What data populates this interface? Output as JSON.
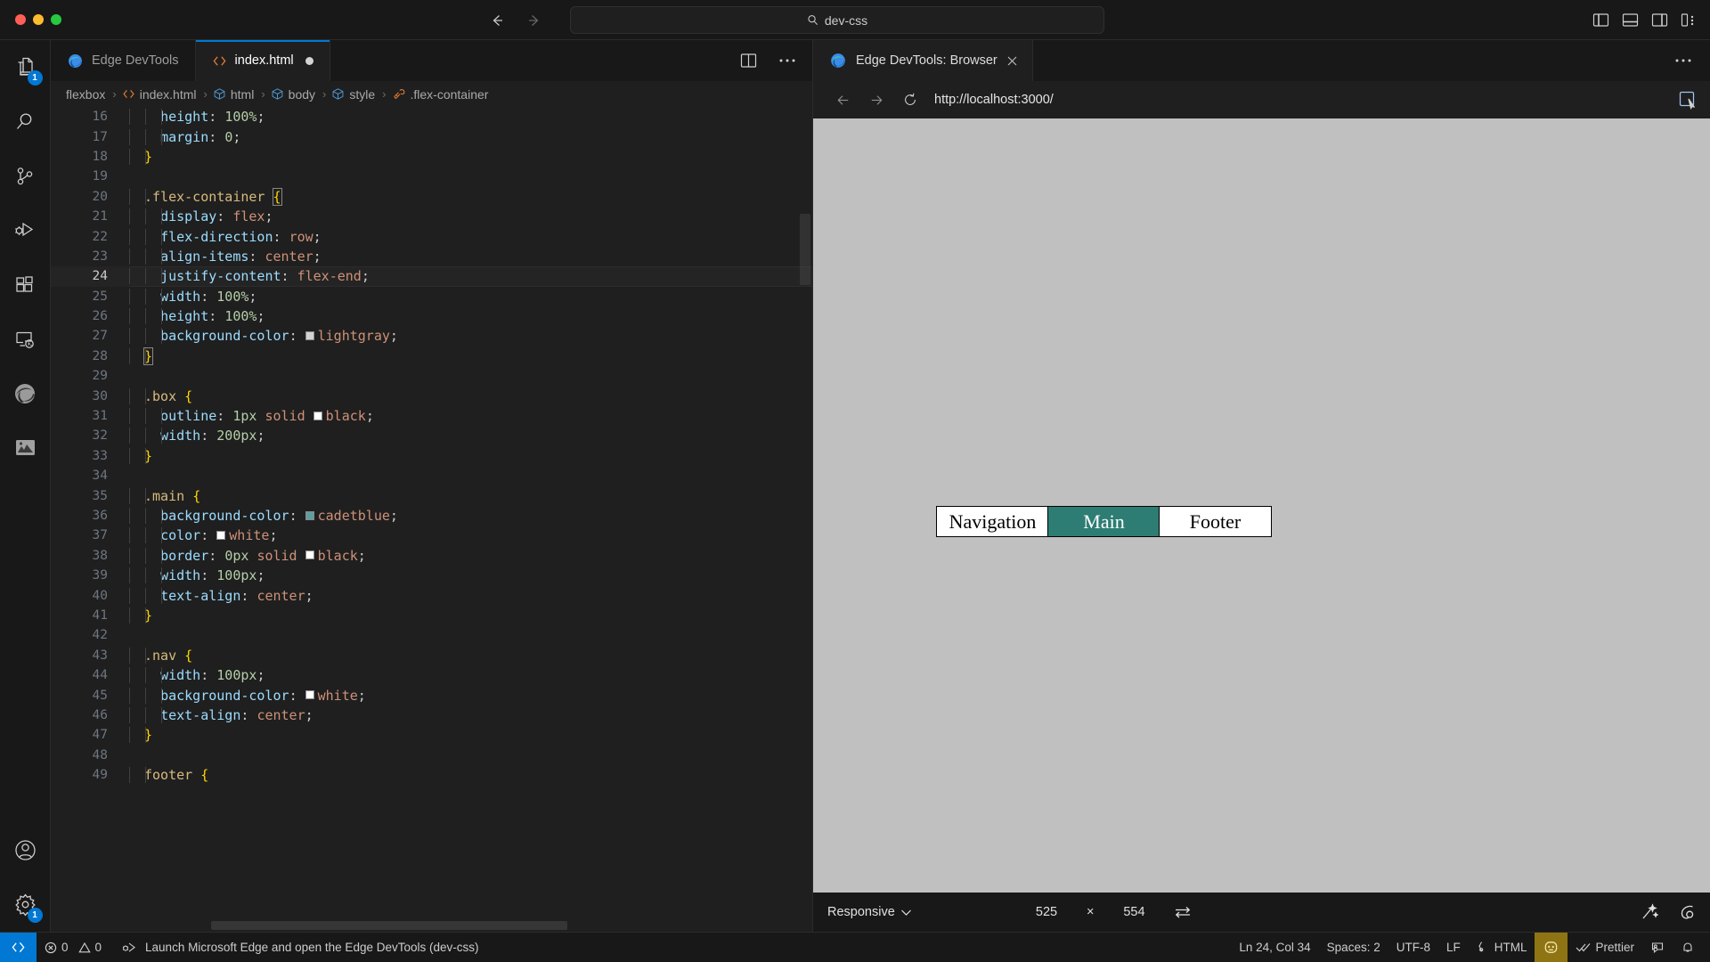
{
  "titlebar": {
    "window_controls": [
      "close",
      "minimize",
      "maximize"
    ],
    "back_icon": "arrow-left-icon",
    "forward_icon": "arrow-right-icon",
    "command_center_text": "dev-css",
    "command_center_icon": "search-icon",
    "layout_icons": [
      "toggle-primary-sidebar-icon",
      "toggle-panel-icon",
      "toggle-secondary-sidebar-icon",
      "customize-layout-icon"
    ]
  },
  "activitybar": {
    "items": [
      {
        "name": "explorer",
        "icon": "files-icon",
        "badge": "1"
      },
      {
        "name": "search",
        "icon": "search-icon",
        "badge": ""
      },
      {
        "name": "source-control",
        "icon": "source-control-icon",
        "badge": ""
      },
      {
        "name": "run-and-debug",
        "icon": "run-debug-icon",
        "badge": ""
      },
      {
        "name": "extensions",
        "icon": "extensions-icon",
        "badge": ""
      },
      {
        "name": "remote-explorer",
        "icon": "remote-explorer-icon",
        "badge": ""
      },
      {
        "name": "edge-devtools",
        "icon": "edge-logo-icon",
        "badge": ""
      },
      {
        "name": "perl-camel",
        "icon": "camel-icon",
        "badge": ""
      }
    ],
    "bottom": [
      {
        "name": "accounts",
        "icon": "account-icon",
        "badge": ""
      },
      {
        "name": "manage-settings",
        "icon": "gear-icon",
        "badge": "1"
      }
    ]
  },
  "editor": {
    "tabs": [
      {
        "label": "Edge DevTools",
        "icon": "edge-logo-icon",
        "active": false,
        "dirty": false
      },
      {
        "label": "index.html",
        "icon": "html-code-icon",
        "active": true,
        "dirty": true
      }
    ],
    "tab_actions": [
      {
        "name": "split-editor",
        "icon": "split-editor-icon"
      },
      {
        "name": "more-actions",
        "icon": "ellipsis-icon"
      }
    ],
    "breadcrumbs": [
      {
        "label": "flexbox",
        "icon": ""
      },
      {
        "label": "index.html",
        "icon": "html-code-icon"
      },
      {
        "label": "html",
        "icon": "element-icon"
      },
      {
        "label": "body",
        "icon": "element-icon"
      },
      {
        "label": "style",
        "icon": "element-icon"
      },
      {
        "label": ".flex-container",
        "icon": "css-ruler-icon"
      }
    ],
    "breadcrumb_separator": "›",
    "first_visible_line": 16,
    "current_line": 24,
    "lines": [
      {
        "n": 16,
        "tokens": [
          {
            "t": "  ",
            "c": "k-punc"
          },
          {
            "t": "height",
            "c": "k-prop"
          },
          {
            "t": ": ",
            "c": "k-punc"
          },
          {
            "t": "100%",
            "c": "k-num"
          },
          {
            "t": ";",
            "c": "k-punc"
          }
        ],
        "indents": [
          1,
          2,
          3
        ],
        "current": false
      },
      {
        "n": 17,
        "tokens": [
          {
            "t": "  ",
            "c": "k-punc"
          },
          {
            "t": "margin",
            "c": "k-prop"
          },
          {
            "t": ": ",
            "c": "k-punc"
          },
          {
            "t": "0",
            "c": "k-num"
          },
          {
            "t": ";",
            "c": "k-punc"
          }
        ],
        "indents": [
          1,
          2,
          3
        ],
        "current": false
      },
      {
        "n": 18,
        "tokens": [
          {
            "t": "}",
            "c": "k-brace"
          }
        ],
        "indents": [
          1,
          2
        ],
        "current": false
      },
      {
        "n": 19,
        "tokens": [],
        "indents": [
          1,
          2
        ],
        "current": false
      },
      {
        "n": 20,
        "tokens": [
          {
            "t": ".flex-container ",
            "c": "k-sel"
          },
          {
            "t": "{",
            "c": "k-brace-hl"
          }
        ],
        "indents": [
          1,
          2
        ],
        "current": false
      },
      {
        "n": 21,
        "tokens": [
          {
            "t": "  ",
            "c": "k-punc"
          },
          {
            "t": "display",
            "c": "k-prop"
          },
          {
            "t": ": ",
            "c": "k-punc"
          },
          {
            "t": "flex",
            "c": "k-val"
          },
          {
            "t": ";",
            "c": "k-punc"
          }
        ],
        "indents": [
          1,
          2,
          3
        ],
        "current": false
      },
      {
        "n": 22,
        "tokens": [
          {
            "t": "  ",
            "c": "k-punc"
          },
          {
            "t": "flex-direction",
            "c": "k-prop"
          },
          {
            "t": ": ",
            "c": "k-punc"
          },
          {
            "t": "row",
            "c": "k-val"
          },
          {
            "t": ";",
            "c": "k-punc"
          }
        ],
        "indents": [
          1,
          2,
          3
        ],
        "current": false
      },
      {
        "n": 23,
        "tokens": [
          {
            "t": "  ",
            "c": "k-punc"
          },
          {
            "t": "align-items",
            "c": "k-prop"
          },
          {
            "t": ": ",
            "c": "k-punc"
          },
          {
            "t": "center",
            "c": "k-val"
          },
          {
            "t": ";",
            "c": "k-punc"
          }
        ],
        "indents": [
          1,
          2,
          3
        ],
        "current": false
      },
      {
        "n": 24,
        "tokens": [
          {
            "t": "  ",
            "c": "k-punc"
          },
          {
            "t": "justify-content",
            "c": "k-prop"
          },
          {
            "t": ": ",
            "c": "k-punc"
          },
          {
            "t": "flex-end",
            "c": "k-val"
          },
          {
            "t": ";",
            "c": "k-punc"
          }
        ],
        "indents": [
          1,
          2,
          3
        ],
        "current": true
      },
      {
        "n": 25,
        "tokens": [
          {
            "t": "  ",
            "c": "k-punc"
          },
          {
            "t": "width",
            "c": "k-prop"
          },
          {
            "t": ": ",
            "c": "k-punc"
          },
          {
            "t": "100%",
            "c": "k-num"
          },
          {
            "t": ";",
            "c": "k-punc"
          }
        ],
        "indents": [
          1,
          2,
          3
        ],
        "current": false
      },
      {
        "n": 26,
        "tokens": [
          {
            "t": "  ",
            "c": "k-punc"
          },
          {
            "t": "height",
            "c": "k-prop"
          },
          {
            "t": ": ",
            "c": "k-punc"
          },
          {
            "t": "100%",
            "c": "k-num"
          },
          {
            "t": ";",
            "c": "k-punc"
          }
        ],
        "indents": [
          1,
          2,
          3
        ],
        "current": false
      },
      {
        "n": 27,
        "tokens": [
          {
            "t": "  ",
            "c": "k-punc"
          },
          {
            "t": "background-color",
            "c": "k-prop"
          },
          {
            "t": ": ",
            "c": "k-punc"
          },
          {
            "t": "__SW:#d3d3d3__",
            "c": "swatch"
          },
          {
            "t": "lightgray",
            "c": "k-val"
          },
          {
            "t": ";",
            "c": "k-punc"
          }
        ],
        "indents": [
          1,
          2,
          3
        ],
        "current": false
      },
      {
        "n": 28,
        "tokens": [
          {
            "t": "}",
            "c": "k-brace-hl"
          }
        ],
        "indents": [
          1,
          2
        ],
        "current": false
      },
      {
        "n": 29,
        "tokens": [],
        "indents": [
          1,
          2
        ],
        "current": false
      },
      {
        "n": 30,
        "tokens": [
          {
            "t": ".box ",
            "c": "k-sel"
          },
          {
            "t": "{",
            "c": "k-brace"
          }
        ],
        "indents": [
          1,
          2
        ],
        "current": false
      },
      {
        "n": 31,
        "tokens": [
          {
            "t": "  ",
            "c": "k-punc"
          },
          {
            "t": "outline",
            "c": "k-prop"
          },
          {
            "t": ": ",
            "c": "k-punc"
          },
          {
            "t": "1px",
            "c": "k-num"
          },
          {
            "t": " ",
            "c": "k-punc"
          },
          {
            "t": "solid ",
            "c": "k-val"
          },
          {
            "t": "__SW:#ffffff__",
            "c": "swatch"
          },
          {
            "t": "black",
            "c": "k-val"
          },
          {
            "t": ";",
            "c": "k-punc"
          }
        ],
        "indents": [
          1,
          2,
          3
        ],
        "current": false
      },
      {
        "n": 32,
        "tokens": [
          {
            "t": "  ",
            "c": "k-punc"
          },
          {
            "t": "width",
            "c": "k-prop"
          },
          {
            "t": ": ",
            "c": "k-punc"
          },
          {
            "t": "200px",
            "c": "k-num"
          },
          {
            "t": ";",
            "c": "k-punc"
          }
        ],
        "indents": [
          1,
          2,
          3
        ],
        "current": false
      },
      {
        "n": 33,
        "tokens": [
          {
            "t": "}",
            "c": "k-brace"
          }
        ],
        "indents": [
          1,
          2
        ],
        "current": false
      },
      {
        "n": 34,
        "tokens": [],
        "indents": [
          1,
          2
        ],
        "current": false
      },
      {
        "n": 35,
        "tokens": [
          {
            "t": ".main ",
            "c": "k-sel"
          },
          {
            "t": "{",
            "c": "k-brace"
          }
        ],
        "indents": [
          1,
          2
        ],
        "current": false
      },
      {
        "n": 36,
        "tokens": [
          {
            "t": "  ",
            "c": "k-punc"
          },
          {
            "t": "background-color",
            "c": "k-prop"
          },
          {
            "t": ": ",
            "c": "k-punc"
          },
          {
            "t": "__SW:#5f9ea0__",
            "c": "swatch"
          },
          {
            "t": "cadetblue",
            "c": "k-val"
          },
          {
            "t": ";",
            "c": "k-punc"
          }
        ],
        "indents": [
          1,
          2,
          3
        ],
        "current": false
      },
      {
        "n": 37,
        "tokens": [
          {
            "t": "  ",
            "c": "k-punc"
          },
          {
            "t": "color",
            "c": "k-prop"
          },
          {
            "t": ": ",
            "c": "k-punc"
          },
          {
            "t": "__SW:#ffffff__",
            "c": "swatch"
          },
          {
            "t": "white",
            "c": "k-val"
          },
          {
            "t": ";",
            "c": "k-punc"
          }
        ],
        "indents": [
          1,
          2,
          3
        ],
        "current": false
      },
      {
        "n": 38,
        "tokens": [
          {
            "t": "  ",
            "c": "k-punc"
          },
          {
            "t": "border",
            "c": "k-prop"
          },
          {
            "t": ": ",
            "c": "k-punc"
          },
          {
            "t": "0px",
            "c": "k-num"
          },
          {
            "t": " ",
            "c": "k-punc"
          },
          {
            "t": "solid ",
            "c": "k-val"
          },
          {
            "t": "__SW:#ffffff__",
            "c": "swatch"
          },
          {
            "t": "black",
            "c": "k-val"
          },
          {
            "t": ";",
            "c": "k-punc"
          }
        ],
        "indents": [
          1,
          2,
          3
        ],
        "current": false
      },
      {
        "n": 39,
        "tokens": [
          {
            "t": "  ",
            "c": "k-punc"
          },
          {
            "t": "width",
            "c": "k-prop"
          },
          {
            "t": ": ",
            "c": "k-punc"
          },
          {
            "t": "100px",
            "c": "k-num"
          },
          {
            "t": ";",
            "c": "k-punc"
          }
        ],
        "indents": [
          1,
          2,
          3
        ],
        "current": false
      },
      {
        "n": 40,
        "tokens": [
          {
            "t": "  ",
            "c": "k-punc"
          },
          {
            "t": "text-align",
            "c": "k-prop"
          },
          {
            "t": ": ",
            "c": "k-punc"
          },
          {
            "t": "center",
            "c": "k-val"
          },
          {
            "t": ";",
            "c": "k-punc"
          }
        ],
        "indents": [
          1,
          2,
          3
        ],
        "current": false
      },
      {
        "n": 41,
        "tokens": [
          {
            "t": "}",
            "c": "k-brace"
          }
        ],
        "indents": [
          1,
          2
        ],
        "current": false
      },
      {
        "n": 42,
        "tokens": [],
        "indents": [
          1,
          2
        ],
        "current": false
      },
      {
        "n": 43,
        "tokens": [
          {
            "t": ".nav ",
            "c": "k-sel"
          },
          {
            "t": "{",
            "c": "k-brace"
          }
        ],
        "indents": [
          1,
          2
        ],
        "current": false
      },
      {
        "n": 44,
        "tokens": [
          {
            "t": "  ",
            "c": "k-punc"
          },
          {
            "t": "width",
            "c": "k-prop"
          },
          {
            "t": ": ",
            "c": "k-punc"
          },
          {
            "t": "100px",
            "c": "k-num"
          },
          {
            "t": ";",
            "c": "k-punc"
          }
        ],
        "indents": [
          1,
          2,
          3
        ],
        "current": false
      },
      {
        "n": 45,
        "tokens": [
          {
            "t": "  ",
            "c": "k-punc"
          },
          {
            "t": "background-color",
            "c": "k-prop"
          },
          {
            "t": ": ",
            "c": "k-punc"
          },
          {
            "t": "__SW:#ffffff__",
            "c": "swatch"
          },
          {
            "t": "white",
            "c": "k-val"
          },
          {
            "t": ";",
            "c": "k-punc"
          }
        ],
        "indents": [
          1,
          2,
          3
        ],
        "current": false
      },
      {
        "n": 46,
        "tokens": [
          {
            "t": "  ",
            "c": "k-punc"
          },
          {
            "t": "text-align",
            "c": "k-prop"
          },
          {
            "t": ": ",
            "c": "k-punc"
          },
          {
            "t": "center",
            "c": "k-val"
          },
          {
            "t": ";",
            "c": "k-punc"
          }
        ],
        "indents": [
          1,
          2,
          3
        ],
        "current": false
      },
      {
        "n": 47,
        "tokens": [
          {
            "t": "}",
            "c": "k-brace"
          }
        ],
        "indents": [
          1,
          2
        ],
        "current": false
      },
      {
        "n": 48,
        "tokens": [],
        "indents": [
          1,
          2
        ],
        "current": false
      },
      {
        "n": 49,
        "tokens": [
          {
            "t": "footer ",
            "c": "k-sel"
          },
          {
            "t": "{",
            "c": "k-brace"
          }
        ],
        "indents": [
          1,
          2
        ],
        "current": false
      }
    ]
  },
  "rightpanel": {
    "tab_label": "Edge DevTools: Browser",
    "tab_icon": "edge-logo-icon",
    "tab_close_icon": "close-icon",
    "more_icon": "ellipsis-icon",
    "url": "http://localhost:3000/",
    "nav_icons": [
      "arrow-left-icon",
      "arrow-right-icon",
      "reload-icon"
    ],
    "inspect_icon": "inspect-element-icon",
    "preview": {
      "background_color": "#c0c0c0",
      "boxes": [
        {
          "label": "Navigation",
          "bg": "#ffffff",
          "color": "#000000"
        },
        {
          "label": "Main",
          "bg": "#2d7d74",
          "color": "#ffffff"
        },
        {
          "label": "Footer",
          "bg": "#ffffff",
          "color": "#000000"
        }
      ]
    },
    "bottombar": {
      "device_label": "Responsive",
      "device_chevron_icon": "chevron-down-icon",
      "width": "525",
      "separator": "×",
      "height": "554",
      "swap_icon": "swap-dimensions-icon",
      "emulate_icon": "emulation-icon",
      "devtools_icon": "devtools-icon"
    }
  },
  "statusbar": {
    "remote_icon": "remote-window-icon",
    "left_items": [
      {
        "name": "errors",
        "icon": "error-icon",
        "label": "0"
      },
      {
        "name": "warnings",
        "icon": "warning-icon",
        "label": "0"
      },
      {
        "name": "launch-task",
        "icon": "debug-alt-icon",
        "label": "Launch Microsoft Edge and open the Edge DevTools (dev-css)"
      }
    ],
    "right_items": [
      {
        "name": "cursor-position",
        "icon": "",
        "label": "Ln 24, Col 34",
        "highlight": false
      },
      {
        "name": "indentation",
        "icon": "",
        "label": "Spaces: 2",
        "highlight": false
      },
      {
        "name": "encoding",
        "icon": "",
        "label": "UTF-8",
        "highlight": false
      },
      {
        "name": "end-of-line",
        "icon": "",
        "label": "LF",
        "highlight": false
      },
      {
        "name": "language-mode",
        "icon": "braces-icon",
        "label": "HTML",
        "highlight": false
      },
      {
        "name": "edge-devtools-status",
        "icon": "devtools-icon",
        "label": "",
        "highlight": true
      },
      {
        "name": "prettier",
        "icon": "checkcheck-icon",
        "label": "Prettier",
        "highlight": false
      },
      {
        "name": "feedback",
        "icon": "feedback-icon",
        "label": "",
        "highlight": false
      },
      {
        "name": "notifications",
        "icon": "bell-icon",
        "label": "",
        "highlight": false
      }
    ]
  }
}
